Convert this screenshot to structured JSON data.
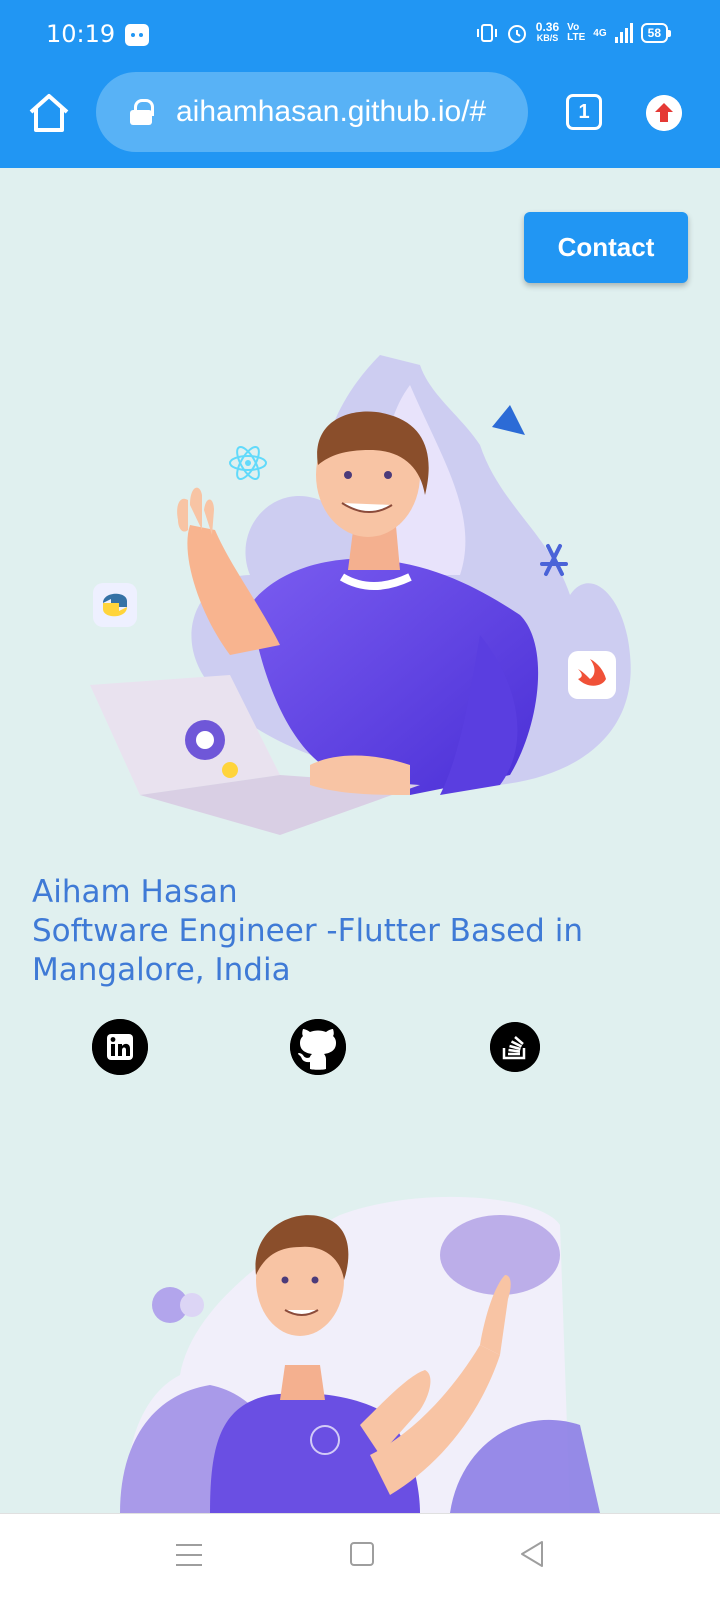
{
  "status_bar": {
    "time": "10:19",
    "net_speed_value": "0.36",
    "net_speed_unit": "KB/S",
    "volte_top": "Vo",
    "volte_bottom": "LTE",
    "network": "4G",
    "battery": "58"
  },
  "browser": {
    "url": "aihamhasan.github.io/#",
    "tab_count": "1"
  },
  "header": {
    "contact_label": "Contact"
  },
  "intro": {
    "name": "Aiham Hasan",
    "tagline": "Software Engineer -Flutter Based in",
    "location": "Mangalore, India"
  },
  "social_links": [
    {
      "icon": "linkedin-icon"
    },
    {
      "icon": "github-icon"
    },
    {
      "icon": "stackoverflow-icon"
    }
  ],
  "colors": {
    "primary": "#2196f3",
    "page_background": "#e0f0ef",
    "intro_text": "#3f7ad6"
  }
}
